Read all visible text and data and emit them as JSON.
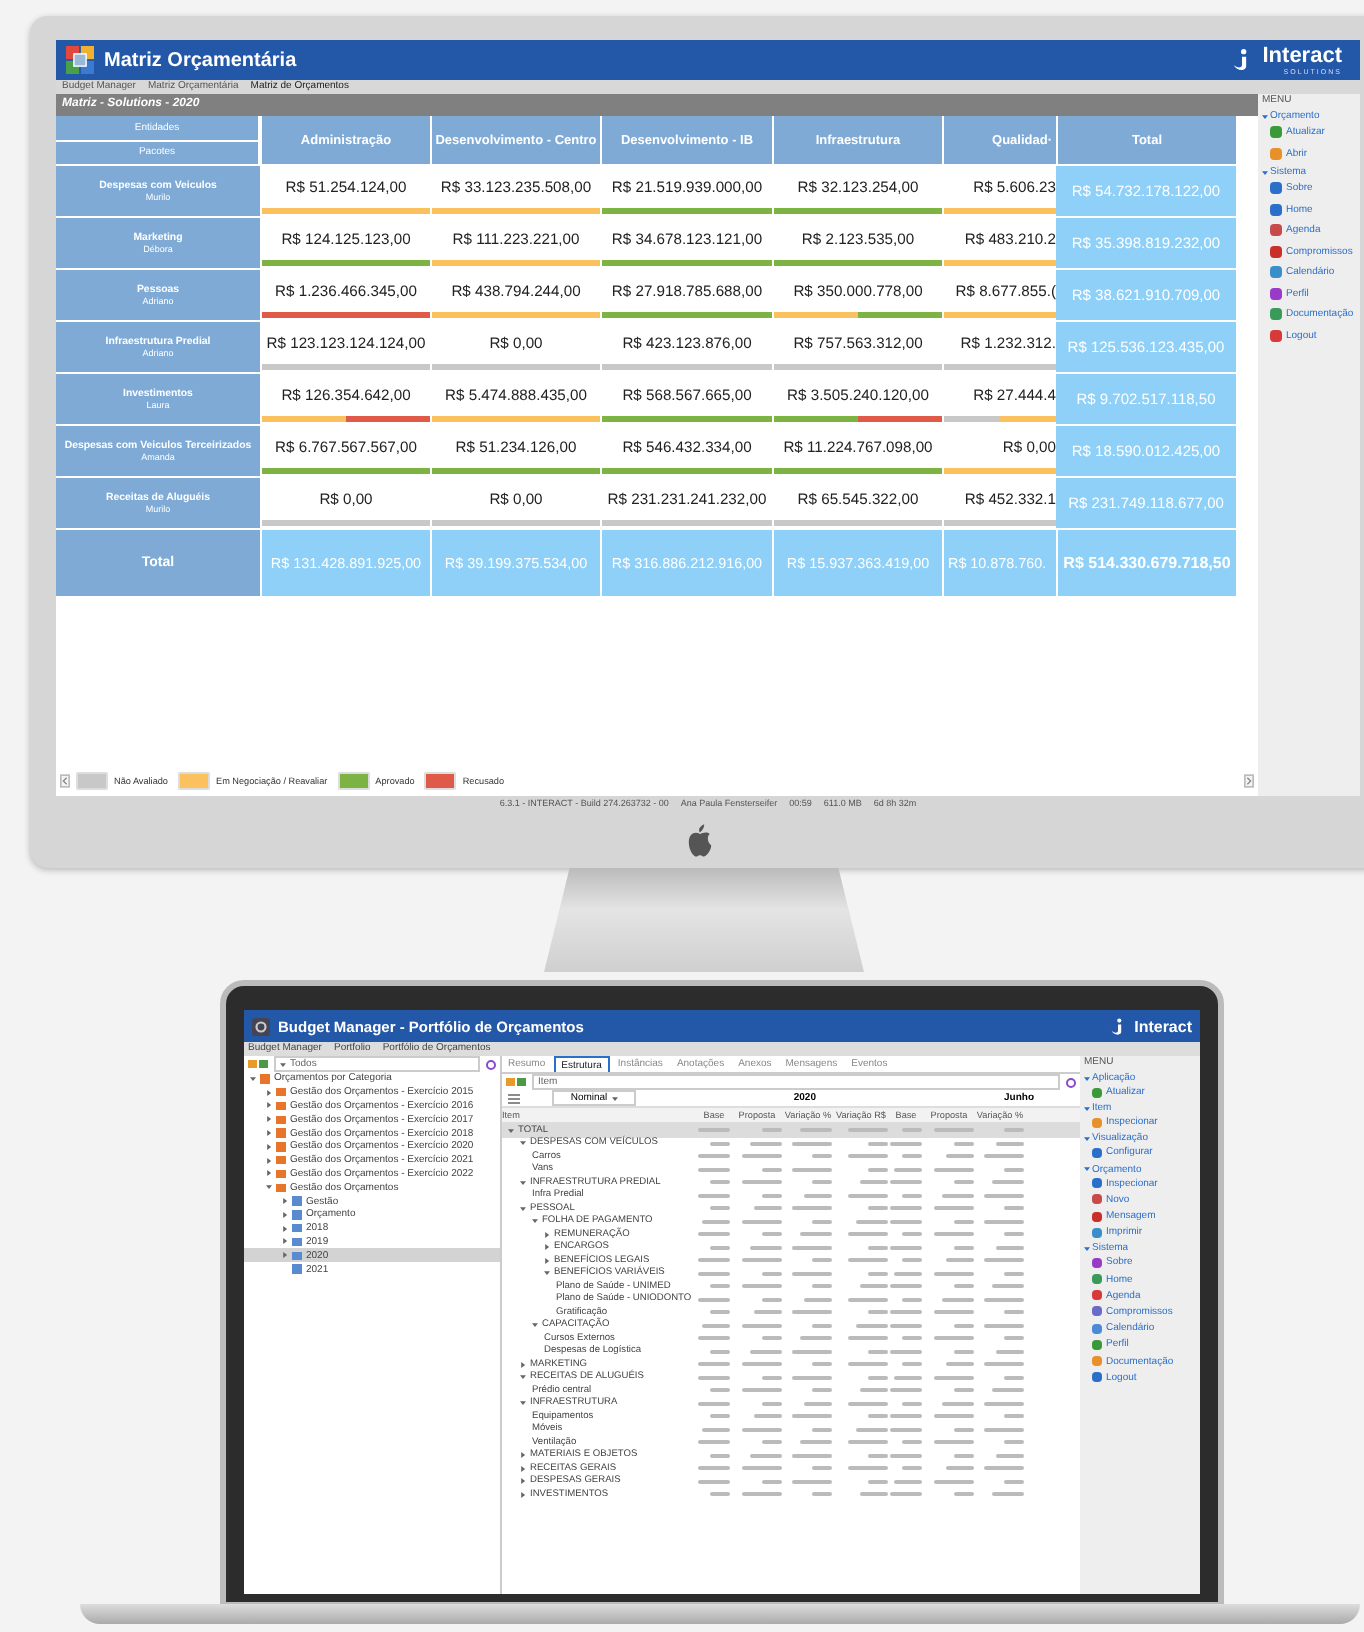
{
  "imac": {
    "app_title": "Matriz Orçamentária",
    "brand": "Interact",
    "brand_sub": "SOLUTIONS",
    "breadcrumb": [
      "Budget Manager",
      "Matriz Orçamentária",
      "Matriz de Orçamentos"
    ],
    "panel_title": "Matriz - Solutions - 2020",
    "header_labels": [
      "Entidades",
      "Pacotes"
    ],
    "columns": [
      "Administração",
      "Desenvolvimento - Centro",
      "Desenvolvimento - IB",
      "Infraestrutura",
      "Qualidad·"
    ],
    "total_label": "Total",
    "rows": [
      {
        "name": "Despesas com Veiculos",
        "owner": "Murilo",
        "cells": [
          {
            "value": "R$ 51.254.124,00",
            "status": [
              {
                "color": "#fbc15e"
              }
            ]
          },
          {
            "value": "R$ 33.123.235.508,00",
            "status": [
              {
                "color": "#fbc15e"
              }
            ]
          },
          {
            "value": "R$ 21.519.939.000,00",
            "status": [
              {
                "color": "#7cb342"
              }
            ]
          },
          {
            "value": "R$ 32.123.254,00",
            "status": [
              {
                "color": "#7cb342"
              }
            ]
          },
          {
            "value": "R$ 5.606.23",
            "status": [
              {
                "color": "#fbc15e"
              }
            ]
          }
        ],
        "total": "R$ 54.732.178.122,00"
      },
      {
        "name": "Marketing",
        "owner": "Débora",
        "cells": [
          {
            "value": "R$ 124.125.123,00",
            "status": [
              {
                "color": "#7cb342"
              }
            ]
          },
          {
            "value": "R$ 111.223.221,00",
            "status": [
              {
                "color": "#fbc15e"
              }
            ]
          },
          {
            "value": "R$ 34.678.123.121,00",
            "status": [
              {
                "color": "#7cb342"
              }
            ]
          },
          {
            "value": "R$ 2.123.535,00",
            "status": [
              {
                "color": "#7cb342"
              }
            ]
          },
          {
            "value": "R$ 483.210.2",
            "status": [
              {
                "color": "#fbc15e"
              }
            ]
          }
        ],
        "total": "R$ 35.398.819.232,00"
      },
      {
        "name": "Pessoas",
        "owner": "Adriano",
        "cells": [
          {
            "value": "R$ 1.236.466.345,00",
            "status": [
              {
                "color": "#e05a4a"
              }
            ]
          },
          {
            "value": "R$ 438.794.244,00",
            "status": [
              {
                "color": "#fbc15e"
              }
            ]
          },
          {
            "value": "R$ 27.918.785.688,00",
            "status": [
              {
                "color": "#7cb342"
              }
            ]
          },
          {
            "value": "R$ 350.000.778,00",
            "status": [
              {
                "color": "#fbc15e"
              },
              {
                "color": "#7cb342"
              }
            ]
          },
          {
            "value": "R$ 8.677.855.(",
            "status": [
              {
                "color": "#fbc15e"
              }
            ]
          }
        ],
        "total": "R$ 38.621.910.709,00"
      },
      {
        "name": "Infraestrutura Predial",
        "owner": "Adriano",
        "cells": [
          {
            "value": "R$ 123.123.124.124,00",
            "status": [
              {
                "color": "#c8c8c8"
              }
            ]
          },
          {
            "value": "R$ 0,00",
            "status": [
              {
                "color": "#c8c8c8"
              }
            ]
          },
          {
            "value": "R$ 423.123.876,00",
            "status": [
              {
                "color": "#c8c8c8"
              }
            ]
          },
          {
            "value": "R$ 757.563.312,00",
            "status": [
              {
                "color": "#c8c8c8"
              }
            ]
          },
          {
            "value": "R$ 1.232.312.",
            "status": [
              {
                "color": "#c8c8c8"
              }
            ]
          }
        ],
        "total": "R$ 125.536.123.435,00"
      },
      {
        "name": "Investimentos",
        "owner": "Laura",
        "cells": [
          {
            "value": "R$ 126.354.642,00",
            "status": [
              {
                "color": "#fbc15e"
              },
              {
                "color": "#e05a4a"
              }
            ]
          },
          {
            "value": "R$ 5.474.888.435,00",
            "status": [
              {
                "color": "#fbc15e"
              }
            ]
          },
          {
            "value": "R$ 568.567.665,00",
            "status": [
              {
                "color": "#7cb342"
              }
            ]
          },
          {
            "value": "R$ 3.505.240.120,00",
            "status": [
              {
                "color": "#7cb342"
              },
              {
                "color": "#e05a4a"
              }
            ]
          },
          {
            "value": "R$ 27.444.4",
            "status": [
              {
                "color": "#c8c8c8"
              },
              {
                "color": "#fbc15e"
              }
            ]
          }
        ],
        "total": "R$ 9.702.517.118,50"
      },
      {
        "name": "Despesas com Veiculos Terceirizados",
        "owner": "Amanda",
        "cells": [
          {
            "value": "R$ 6.767.567.567,00",
            "status": [
              {
                "color": "#7cb342"
              }
            ]
          },
          {
            "value": "R$ 51.234.126,00",
            "status": [
              {
                "color": "#7cb342"
              }
            ]
          },
          {
            "value": "R$ 546.432.334,00",
            "status": [
              {
                "color": "#7cb342"
              }
            ]
          },
          {
            "value": "R$ 11.224.767.098,00",
            "status": [
              {
                "color": "#7cb342"
              }
            ]
          },
          {
            "value": "R$ 0,00",
            "status": [
              {
                "color": "#fbc15e"
              }
            ]
          }
        ],
        "total": "R$ 18.590.012.425,00"
      },
      {
        "name": "Receitas de Aluguéis",
        "owner": "Murilo",
        "cells": [
          {
            "value": "R$ 0,00",
            "status": [
              {
                "color": "#c8c8c8"
              }
            ]
          },
          {
            "value": "R$ 0,00",
            "status": [
              {
                "color": "#c8c8c8"
              }
            ]
          },
          {
            "value": "R$ 231.231.241.232,00",
            "status": [
              {
                "color": "#c8c8c8"
              }
            ]
          },
          {
            "value": "R$ 65.545.322,00",
            "status": [
              {
                "color": "#c8c8c8"
              }
            ]
          },
          {
            "value": "R$ 452.332.1",
            "status": [
              {
                "color": "#c8c8c8"
              }
            ]
          }
        ],
        "total": "R$ 231.749.118.677,00"
      }
    ],
    "total_row": {
      "label": "Total",
      "values": [
        "R$ 131.428.891.925,00",
        "R$ 39.199.375.534,00",
        "R$ 316.886.212.916,00",
        "R$ 15.937.363.419,00",
        "R$ 10.878.760."
      ],
      "grand_total": "R$ 514.330.679.718,50"
    },
    "legend": [
      {
        "label": "Não Avaliado",
        "color": "#c8c8c8"
      },
      {
        "label": "Em Negociação / Reavaliar",
        "color": "#fbc15e"
      },
      {
        "label": "Aprovado",
        "color": "#7cb342"
      },
      {
        "label": "Recusado",
        "color": "#e05a4a"
      }
    ],
    "status_bar": [
      "6.3.1 - INTERACT - Build 274.263732 - 00",
      "Ana Paula Fensterseifer",
      "00:59",
      "611.0 MB",
      "6d 8h 32m"
    ],
    "menu": {
      "title": "MENU",
      "groups": [
        {
          "label": "Orçamento",
          "items": [
            "Atualizar",
            "Abrir"
          ]
        },
        {
          "label": "Sistema",
          "items": [
            "Sobre",
            "Home",
            "Agenda",
            "Compromissos",
            "Calendário",
            "Perfil",
            "Documentação",
            "Logout"
          ]
        }
      ]
    }
  },
  "laptop": {
    "app_title": "Budget Manager - Portfólio de Orçamentos",
    "brand": "Interact",
    "breadcrumb": [
      "Budget Manager",
      "Portfolio",
      "Portfólio de Orçamentos"
    ],
    "tree_filter": "Todos",
    "tree": [
      {
        "label": "Orçamentos por Categoria",
        "expanded": true,
        "selected": false,
        "children": [
          {
            "label": "Gestão dos Orçamentos - Exercício 2015",
            "expanded": false,
            "selected": false
          },
          {
            "label": "Gestão dos Orçamentos - Exercício 2016",
            "expanded": false,
            "selected": false
          },
          {
            "label": "Gestão dos Orçamentos - Exercício 2017",
            "expanded": false,
            "selected": false
          },
          {
            "label": "Gestão dos Orçamentos - Exercício 2018",
            "expanded": false,
            "selected": false
          },
          {
            "label": "Gestão dos Orçamentos - Exercício 2020",
            "expanded": false,
            "selected": false
          },
          {
            "label": "Gestão dos Orçamentos - Exercício 2021",
            "expanded": false,
            "selected": false
          },
          {
            "label": "Gestão dos Orçamentos - Exercício 2022",
            "expanded": false,
            "selected": false
          },
          {
            "label": "Gestão dos Orçamentos",
            "expanded": true,
            "selected": false,
            "children": [
              {
                "label": "Gestão",
                "expanded": false,
                "selected": false
              },
              {
                "label": "Orçamento",
                "expanded": false,
                "selected": false
              },
              {
                "label": "2018",
                "expanded": false,
                "selected": false
              },
              {
                "label": "2019",
                "expanded": false,
                "selected": false
              },
              {
                "label": "2020",
                "expanded": false,
                "selected": true
              },
              {
                "label": "2021",
                "selected": false
              }
            ]
          }
        ]
      }
    ],
    "tabs": [
      {
        "label": "Resumo",
        "selected": false
      },
      {
        "label": "Estrutura",
        "selected": true
      },
      {
        "label": "Instâncias",
        "selected": false
      },
      {
        "label": "Anotações",
        "selected": false
      },
      {
        "label": "Anexos",
        "selected": false
      },
      {
        "label": "Mensagens",
        "selected": false
      },
      {
        "label": "Eventos",
        "selected": false
      }
    ],
    "filter_placeholder": "Item",
    "view_select": "Nominal",
    "periods": [
      "2020",
      "Junho"
    ],
    "columns": [
      "Item",
      "Base",
      "Proposta",
      "Variação %",
      "Variação R$",
      "Base",
      "Proposta",
      "Variação %"
    ],
    "items": [
      {
        "label": "TOTAL",
        "expanded": true,
        "children": [
          {
            "label": "DESPESAS COM VEÍCULOS",
            "expanded": true,
            "children": [
              {
                "label": "Carros"
              },
              {
                "label": "Vans"
              }
            ]
          },
          {
            "label": "INFRAESTRUTURA PREDIAL",
            "expanded": true,
            "children": [
              {
                "label": "Infra Predial"
              }
            ]
          },
          {
            "label": "PESSOAL",
            "expanded": true,
            "children": [
              {
                "label": "FOLHA DE PAGAMENTO",
                "expanded": true,
                "children": [
                  {
                    "label": "REMUNERAÇÃO",
                    "expanded": false
                  },
                  {
                    "label": "ENCARGOS",
                    "expanded": false
                  },
                  {
                    "label": "BENEFÍCIOS LEGAIS",
                    "expanded": false
                  },
                  {
                    "label": "BENEFÍCIOS VARIÁVEIS",
                    "expanded": true,
                    "children": [
                      {
                        "label": "Plano de Saúde - UNIMED"
                      },
                      {
                        "label": "Plano de Saúde - UNIODONTO"
                      },
                      {
                        "label": "Gratificação"
                      }
                    ]
                  }
                ]
              },
              {
                "label": "CAPACITAÇÃO",
                "expanded": true,
                "children": [
                  {
                    "label": "Cursos Externos"
                  },
                  {
                    "label": "Despesas de Logística"
                  }
                ]
              }
            ]
          },
          {
            "label": "MARKETING",
            "expanded": false
          },
          {
            "label": "RECEITAS DE ALUGUÉIS",
            "expanded": true,
            "children": [
              {
                "label": "Prédio central"
              }
            ]
          },
          {
            "label": "INFRAESTRUTURA",
            "expanded": true,
            "children": [
              {
                "label": "Equipamentos"
              },
              {
                "label": "Móveis"
              },
              {
                "label": "Ventilação"
              }
            ]
          },
          {
            "label": "MATERIAIS E OBJETOS",
            "expanded": false
          },
          {
            "label": "RECEITAS GERAIS",
            "expanded": false
          },
          {
            "label": "DESPESAS GERAIS",
            "expanded": false
          },
          {
            "label": "INVESTIMENTOS",
            "expanded": false
          }
        ]
      }
    ],
    "menu": {
      "title": "MENU",
      "groups": [
        {
          "label": "Aplicação",
          "items": [
            "Atualizar"
          ]
        },
        {
          "label": "Item",
          "items": [
            "Inspecionar"
          ]
        },
        {
          "label": "Visualização",
          "items": [
            "Configurar"
          ]
        },
        {
          "label": "Orçamento",
          "items": [
            "Inspecionar",
            "Novo",
            "Mensagem",
            "Imprimir"
          ]
        },
        {
          "label": "Sistema",
          "items": [
            "Sobre",
            "Home",
            "Agenda",
            "Compromissos",
            "Calendário",
            "Perfil",
            "Documentação",
            "Logout"
          ]
        }
      ]
    }
  }
}
